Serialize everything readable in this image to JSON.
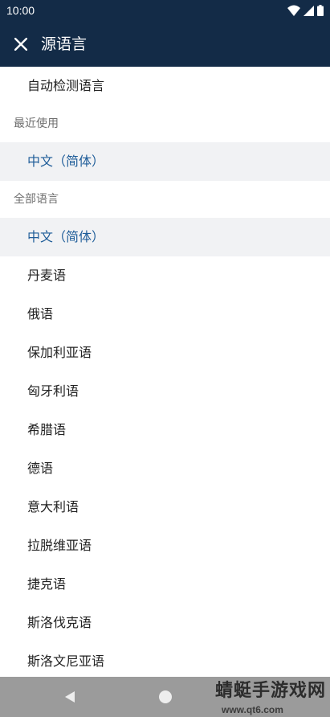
{
  "status_bar": {
    "time": "10:00"
  },
  "header": {
    "title": "源语言"
  },
  "auto_detect": {
    "label": "自动检测语言"
  },
  "recent": {
    "header": "最近使用",
    "items": [
      {
        "label": "中文（简体）",
        "selected": true
      }
    ]
  },
  "all_languages": {
    "header": "全部语言",
    "items": [
      {
        "label": "中文（简体）",
        "selected": true
      },
      {
        "label": "丹麦语"
      },
      {
        "label": "俄语"
      },
      {
        "label": "保加利亚语"
      },
      {
        "label": "匈牙利语"
      },
      {
        "label": "希腊语"
      },
      {
        "label": "德语"
      },
      {
        "label": "意大利语"
      },
      {
        "label": "拉脱维亚语"
      },
      {
        "label": "捷克语"
      },
      {
        "label": "斯洛伐克语"
      },
      {
        "label": "斯洛文尼亚语"
      }
    ]
  },
  "watermark": {
    "title": "蜻蜓手游戏网",
    "url": "www.qt6.com"
  },
  "colors": {
    "app_bar": "#132b47",
    "selected_text": "#1f5d99",
    "selected_background": "#f1f2f4",
    "nav_bar": "#9b9b9b"
  },
  "icons": {
    "close": "close-icon",
    "wifi": "wifi-icon",
    "cell_signal": "cell-signal-icon",
    "battery": "battery-icon",
    "nav_back": "nav-back-icon",
    "nav_home": "nav-home-icon"
  }
}
